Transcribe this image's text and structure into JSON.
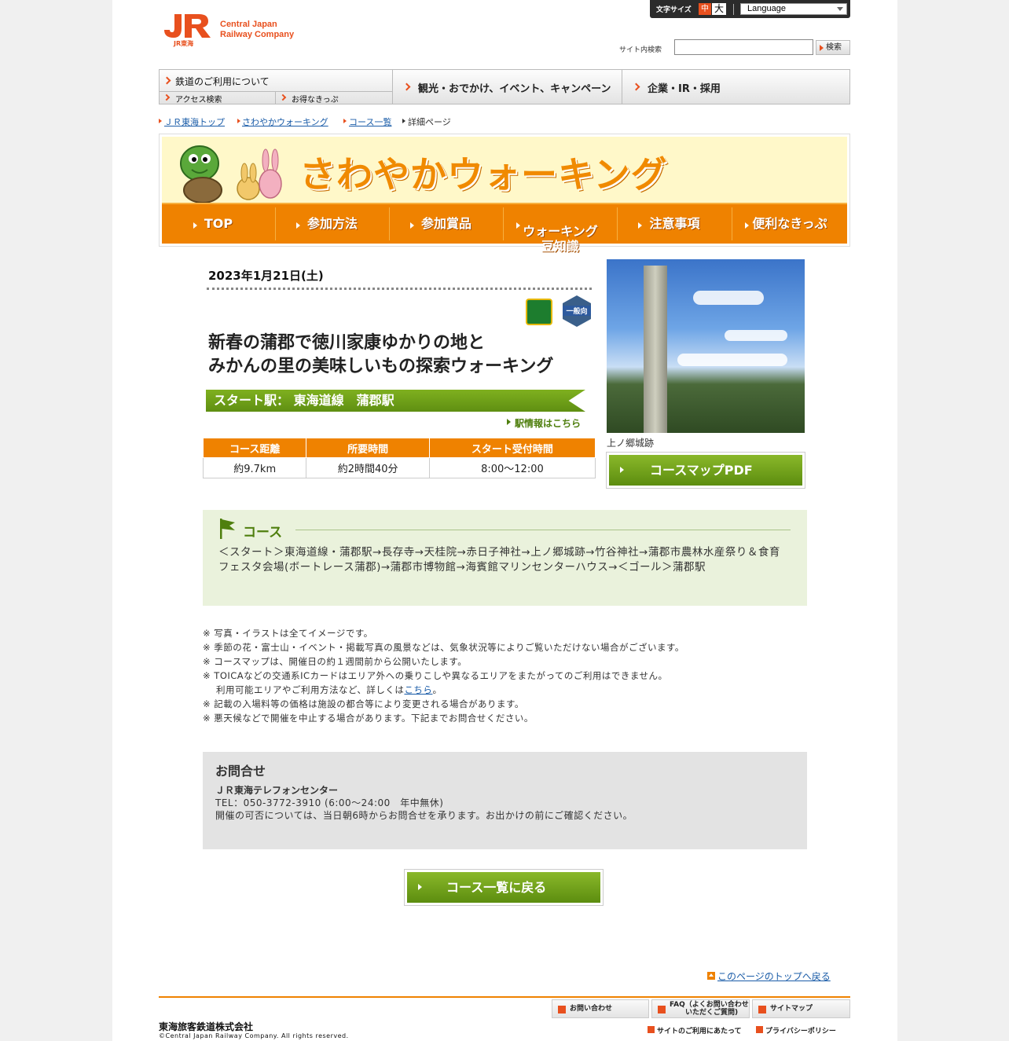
{
  "header": {
    "logo_mark": "JR",
    "logo_sub": "JR東海",
    "logo_text_line1": "Central Japan",
    "logo_text_line2": "Railway Company",
    "font_size_label": "文字サイズ",
    "font_size_mid": "中",
    "font_size_big": "大",
    "language_label": "Language",
    "search_label": "サイト内検索",
    "search_value": "",
    "search_button": "検索"
  },
  "global_nav": {
    "rail_main": "鉄道のご利用について",
    "rail_sub1": "アクセス検索",
    "rail_sub2": "お得なきっぷ",
    "tourism": "観光・おでかけ、イベント、キャンペーン",
    "corporate": "企業・IR・採用"
  },
  "breadcrumb": {
    "top": "ＪＲ東海トップ",
    "walking": "さわやかウォーキング",
    "course_list": "コース一覧",
    "current": "詳細ページ"
  },
  "banner": {
    "title": "さわやかウォーキング",
    "nav": [
      "TOP",
      "参加方法",
      "参加賞品",
      "ウォーキング\n豆知識",
      "注意事項",
      "便利なきっぷ"
    ]
  },
  "detail": {
    "date": "2023年1月21日(土)",
    "badge_general": "一般向",
    "title_line1": "新春の蒲郡で徳川家康ゆかりの地と",
    "title_line2": "みかんの里の美味しいもの探索ウォーキング",
    "start_station": "スタート駅：  東海道線　蒲郡駅",
    "station_link": "駅情報はこちら",
    "table_headers": [
      "コース距離",
      "所要時間",
      "スタート受付時間"
    ],
    "table_values": [
      "約9.7km",
      "約2時間40分",
      "8:00～12:00"
    ],
    "photo_caption": "上ノ郷城跡",
    "pdf_button": "コースマップPDF"
  },
  "course": {
    "heading": "コース",
    "text": "＜スタート＞東海道線・蒲郡駅→長存寺→天桂院→赤日子神社→上ノ郷城跡→竹谷神社→蒲郡市農林水産祭り＆食育フェスタ会場(ボートレース蒲郡)→蒲郡市博物館→海賓館マリンセンターハウス→＜ゴール＞蒲郡駅"
  },
  "notes": {
    "n1": "※ 写真・イラストは全てイメージです。",
    "n2": "※ 季節の花・富士山・イベント・掲載写真の風景などは、気象状況等によりご覧いただけない場合がございます。",
    "n3": "※ コースマップは、開催日の約１週間前から公開いたします。",
    "n4": "※ TOICAなどの交通系ICカードはエリア外への乗りこしや異なるエリアをまたがってのご利用はできません。",
    "n4b_pre": "利用可能エリアやご利用方法など、詳しくは",
    "n4b_link": "こちら",
    "n4b_post": "。",
    "n5": "※ 記載の入場料等の価格は施設の都合等により変更される場合があります。",
    "n6": "※ 悪天候などで開催を中止する場合があります。下記までお問合せください。"
  },
  "contact": {
    "heading": "お問合せ",
    "name": "ＪＲ東海テレフォンセンター",
    "tel": "TEL：050-3772-3910 (6:00～24:00　年中無休)",
    "note": "開催の可否については、当日朝6時からお問合せを承ります。お出かけの前にご確認ください。"
  },
  "back_button": "コース一覧に戻る",
  "page_top": "このページのトップへ戻る",
  "footer": {
    "contact": "お問い合わせ",
    "faq_line1": "FAQ（よくお問い合わせ",
    "faq_line2": "いただくご質問)",
    "sitemap": "サイトマップ",
    "terms": "サイトのご利用にあたって",
    "privacy": "プライバシーポリシー",
    "company": "東海旅客鉄道株式会社",
    "copyright": "©Central Japan Railway Company.  All rights reserved."
  },
  "colors": {
    "jr_orange": "#e8501e",
    "walking_orange": "#ef8200",
    "walking_green": "#5f8f12",
    "link_blue": "#1a5ca8"
  }
}
